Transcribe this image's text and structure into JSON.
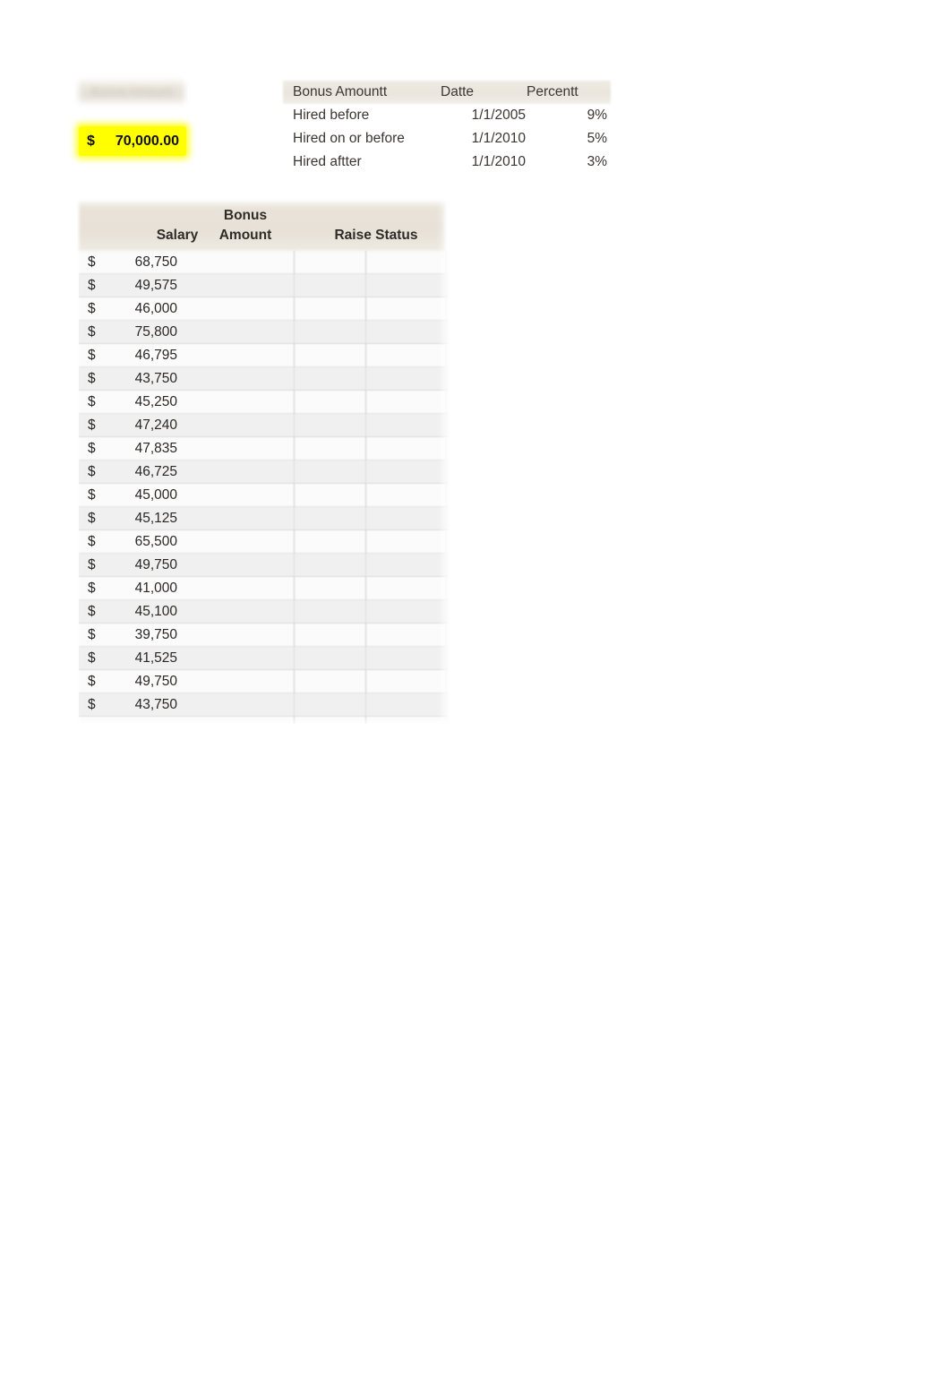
{
  "input_block": {
    "label": "Bonus Amount",
    "currency_symbol": "$",
    "value": "70,000.00",
    "highlight_color": "#FFFF00"
  },
  "reference_table": {
    "headers": {
      "criteria": "Bonus Amountt",
      "date": "Datte",
      "percent": "Percentt"
    },
    "rows": [
      {
        "criteria": "Hired before",
        "date": "1/1/2005",
        "percent": "9%"
      },
      {
        "criteria": "Hired on or before",
        "date": "1/1/2010",
        "percent": "5%"
      },
      {
        "criteria": "Hired aftter",
        "date": "1/1/2010",
        "percent": "3%"
      }
    ]
  },
  "data_table": {
    "headers": {
      "salary": "Salary",
      "bonus_amount_line1": "Bonus",
      "bonus_amount_line2": "Amount",
      "raise_status": "Raise Status"
    },
    "currency_symbol": "$",
    "rows": [
      {
        "salary": "68,750",
        "bonus_amount": "",
        "raise_status": ""
      },
      {
        "salary": "49,575",
        "bonus_amount": "",
        "raise_status": ""
      },
      {
        "salary": "46,000",
        "bonus_amount": "",
        "raise_status": ""
      },
      {
        "salary": "75,800",
        "bonus_amount": "",
        "raise_status": ""
      },
      {
        "salary": "46,795",
        "bonus_amount": "",
        "raise_status": ""
      },
      {
        "salary": "43,750",
        "bonus_amount": "",
        "raise_status": ""
      },
      {
        "salary": "45,250",
        "bonus_amount": "",
        "raise_status": ""
      },
      {
        "salary": "47,240",
        "bonus_amount": "",
        "raise_status": ""
      },
      {
        "salary": "47,835",
        "bonus_amount": "",
        "raise_status": ""
      },
      {
        "salary": "46,725",
        "bonus_amount": "",
        "raise_status": ""
      },
      {
        "salary": "45,000",
        "bonus_amount": "",
        "raise_status": ""
      },
      {
        "salary": "45,125",
        "bonus_amount": "",
        "raise_status": ""
      },
      {
        "salary": "65,500",
        "bonus_amount": "",
        "raise_status": ""
      },
      {
        "salary": "49,750",
        "bonus_amount": "",
        "raise_status": ""
      },
      {
        "salary": "41,000",
        "bonus_amount": "",
        "raise_status": ""
      },
      {
        "salary": "45,100",
        "bonus_amount": "",
        "raise_status": ""
      },
      {
        "salary": "39,750",
        "bonus_amount": "",
        "raise_status": ""
      },
      {
        "salary": "41,525",
        "bonus_amount": "",
        "raise_status": ""
      },
      {
        "salary": "49,750",
        "bonus_amount": "",
        "raise_status": ""
      },
      {
        "salary": "43,750",
        "bonus_amount": "",
        "raise_status": ""
      }
    ]
  },
  "theme": {
    "page_background": "#FFFFFF",
    "header_band": "#E8E2D8",
    "text_color": "#332F2B",
    "row_band": "#E8E8E8"
  }
}
